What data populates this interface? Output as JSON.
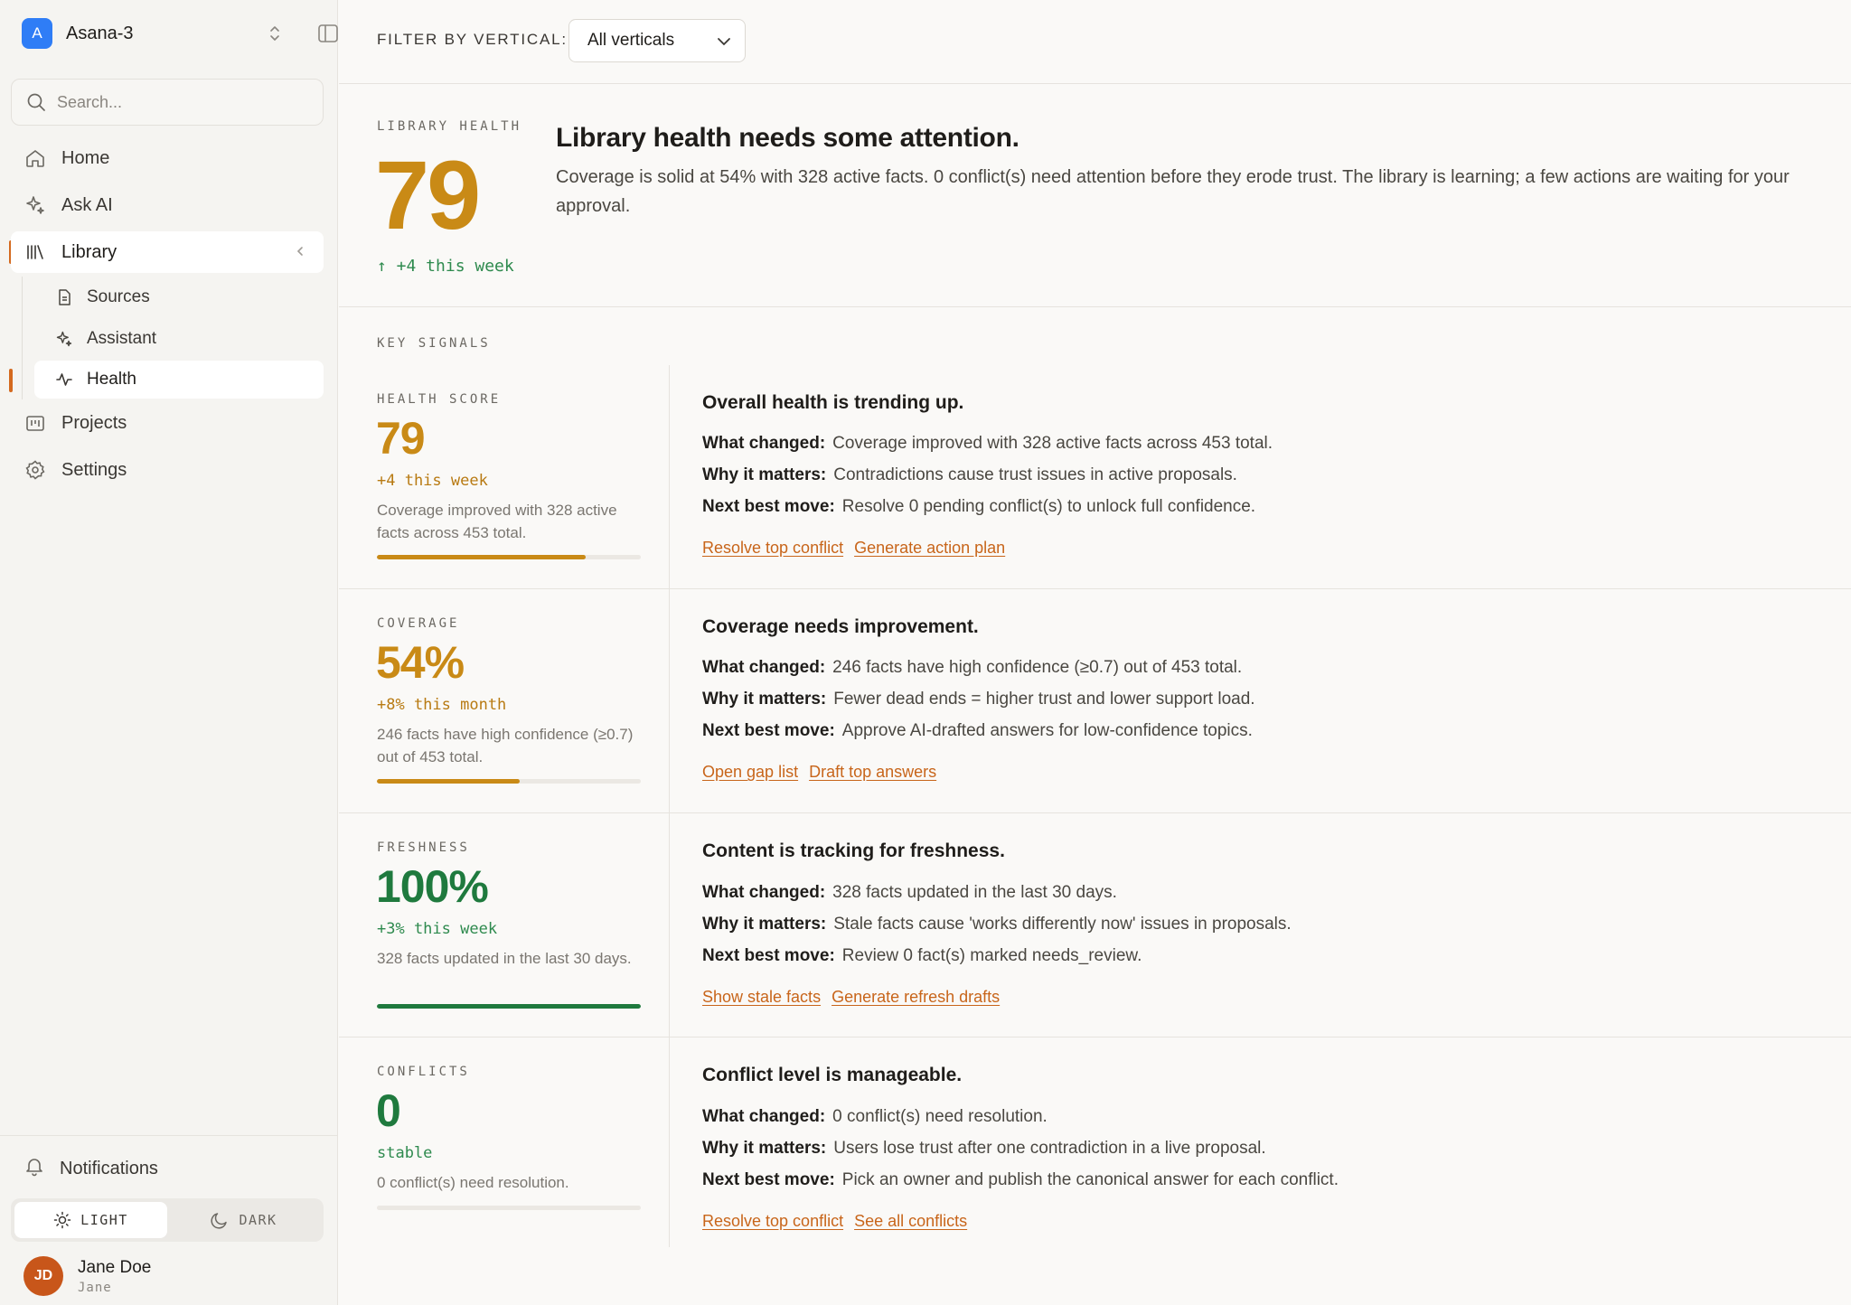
{
  "workspace": {
    "badge": "A",
    "name": "Asana-3"
  },
  "search": {
    "placeholder": "Search..."
  },
  "nav": {
    "home": "Home",
    "ask_ai": "Ask AI",
    "library": "Library",
    "sources": "Sources",
    "assistant": "Assistant",
    "health": "Health",
    "projects": "Projects",
    "settings": "Settings"
  },
  "footer": {
    "notifications": "Notifications",
    "theme_light": "LIGHT",
    "theme_dark": "DARK",
    "theme_selected": "LIGHT",
    "user_initials": "JD",
    "user_name": "Jane Doe",
    "user_handle": "Jane"
  },
  "filter": {
    "label": "FILTER BY VERTICAL:",
    "selected": "All verticals"
  },
  "hero": {
    "eyebrow": "LIBRARY HEALTH",
    "score": "79",
    "delta": "↑ +4 this week",
    "title": "Library health needs some attention.",
    "body": "Coverage is solid at 54% with 328 active facts. 0 conflict(s) need attention before they erode trust. The library is learning; a few actions are waiting for your approval."
  },
  "key_signals_label": "KEY SIGNALS",
  "labels": {
    "what_changed": "What changed:",
    "why_matters": "Why it matters:",
    "next_move": "Next best move:"
  },
  "signals": [
    {
      "eyebrow": "HEALTH SCORE",
      "value": "79",
      "delta": "+4 this week",
      "desc": "Coverage improved with 328 active facts across 453 total.",
      "progress": 0.79,
      "tone": "amber",
      "title": "Overall health is trending up.",
      "what_changed": "Coverage improved with 328 active facts across 453 total.",
      "why_matters": "Contradictions cause trust issues in active proposals.",
      "next_move": "Resolve 0 pending conflict(s) to unlock full confidence.",
      "actions": [
        "Resolve top conflict",
        "Generate action plan"
      ]
    },
    {
      "eyebrow": "COVERAGE",
      "value": "54%",
      "delta": "+8% this month",
      "desc": "246 facts have high confidence (≥0.7) out of 453 total.",
      "progress": 0.54,
      "tone": "amber",
      "title": "Coverage needs improvement.",
      "what_changed": "246 facts have high confidence (≥0.7) out of 453 total.",
      "why_matters": "Fewer dead ends = higher trust and lower support load.",
      "next_move": "Approve AI-drafted answers for low-confidence topics.",
      "actions": [
        "Open gap list",
        "Draft top answers"
      ]
    },
    {
      "eyebrow": "FRESHNESS",
      "value": "100%",
      "delta": "+3% this week",
      "desc": "328 facts updated in the last 30 days.",
      "progress": 1.0,
      "tone": "green",
      "title": "Content is tracking for freshness.",
      "what_changed": "328 facts updated in the last 30 days.",
      "why_matters": "Stale facts cause 'works differently now' issues in proposals.",
      "next_move": "Review 0 fact(s) marked needs_review.",
      "actions": [
        "Show stale facts",
        "Generate refresh drafts"
      ]
    },
    {
      "eyebrow": "CONFLICTS",
      "value": "0",
      "delta": "stable",
      "desc": "0 conflict(s) need resolution.",
      "progress": 0.0,
      "tone": "green",
      "title": "Conflict level is manageable.",
      "what_changed": "0 conflict(s) need resolution.",
      "why_matters": "Users lose trust after one contradiction in a live proposal.",
      "next_move": "Pick an owner and publish the canonical answer for each conflict.",
      "actions": [
        "Resolve top conflict",
        "See all conflicts"
      ]
    }
  ],
  "colors": {
    "accent": "#d4691e",
    "amber": "#c98a16",
    "green": "#1f7a3e",
    "link": "#c8651a",
    "brand_badge": "#2f7df6"
  }
}
